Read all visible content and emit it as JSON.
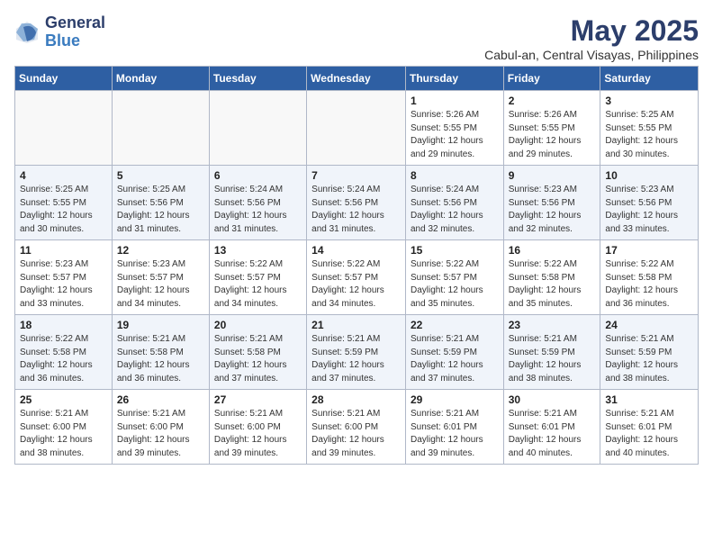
{
  "logo": {
    "general": "General",
    "blue": "Blue"
  },
  "header": {
    "month_year": "May 2025",
    "location": "Cabul-an, Central Visayas, Philippines"
  },
  "weekdays": [
    "Sunday",
    "Monday",
    "Tuesday",
    "Wednesday",
    "Thursday",
    "Friday",
    "Saturday"
  ],
  "weeks": [
    [
      {
        "day": "",
        "info": ""
      },
      {
        "day": "",
        "info": ""
      },
      {
        "day": "",
        "info": ""
      },
      {
        "day": "",
        "info": ""
      },
      {
        "day": "1",
        "info": "Sunrise: 5:26 AM\nSunset: 5:55 PM\nDaylight: 12 hours\nand 29 minutes."
      },
      {
        "day": "2",
        "info": "Sunrise: 5:26 AM\nSunset: 5:55 PM\nDaylight: 12 hours\nand 29 minutes."
      },
      {
        "day": "3",
        "info": "Sunrise: 5:25 AM\nSunset: 5:55 PM\nDaylight: 12 hours\nand 30 minutes."
      }
    ],
    [
      {
        "day": "4",
        "info": "Sunrise: 5:25 AM\nSunset: 5:55 PM\nDaylight: 12 hours\nand 30 minutes."
      },
      {
        "day": "5",
        "info": "Sunrise: 5:25 AM\nSunset: 5:56 PM\nDaylight: 12 hours\nand 31 minutes."
      },
      {
        "day": "6",
        "info": "Sunrise: 5:24 AM\nSunset: 5:56 PM\nDaylight: 12 hours\nand 31 minutes."
      },
      {
        "day": "7",
        "info": "Sunrise: 5:24 AM\nSunset: 5:56 PM\nDaylight: 12 hours\nand 31 minutes."
      },
      {
        "day": "8",
        "info": "Sunrise: 5:24 AM\nSunset: 5:56 PM\nDaylight: 12 hours\nand 32 minutes."
      },
      {
        "day": "9",
        "info": "Sunrise: 5:23 AM\nSunset: 5:56 PM\nDaylight: 12 hours\nand 32 minutes."
      },
      {
        "day": "10",
        "info": "Sunrise: 5:23 AM\nSunset: 5:56 PM\nDaylight: 12 hours\nand 33 minutes."
      }
    ],
    [
      {
        "day": "11",
        "info": "Sunrise: 5:23 AM\nSunset: 5:57 PM\nDaylight: 12 hours\nand 33 minutes."
      },
      {
        "day": "12",
        "info": "Sunrise: 5:23 AM\nSunset: 5:57 PM\nDaylight: 12 hours\nand 34 minutes."
      },
      {
        "day": "13",
        "info": "Sunrise: 5:22 AM\nSunset: 5:57 PM\nDaylight: 12 hours\nand 34 minutes."
      },
      {
        "day": "14",
        "info": "Sunrise: 5:22 AM\nSunset: 5:57 PM\nDaylight: 12 hours\nand 34 minutes."
      },
      {
        "day": "15",
        "info": "Sunrise: 5:22 AM\nSunset: 5:57 PM\nDaylight: 12 hours\nand 35 minutes."
      },
      {
        "day": "16",
        "info": "Sunrise: 5:22 AM\nSunset: 5:58 PM\nDaylight: 12 hours\nand 35 minutes."
      },
      {
        "day": "17",
        "info": "Sunrise: 5:22 AM\nSunset: 5:58 PM\nDaylight: 12 hours\nand 36 minutes."
      }
    ],
    [
      {
        "day": "18",
        "info": "Sunrise: 5:22 AM\nSunset: 5:58 PM\nDaylight: 12 hours\nand 36 minutes."
      },
      {
        "day": "19",
        "info": "Sunrise: 5:21 AM\nSunset: 5:58 PM\nDaylight: 12 hours\nand 36 minutes."
      },
      {
        "day": "20",
        "info": "Sunrise: 5:21 AM\nSunset: 5:58 PM\nDaylight: 12 hours\nand 37 minutes."
      },
      {
        "day": "21",
        "info": "Sunrise: 5:21 AM\nSunset: 5:59 PM\nDaylight: 12 hours\nand 37 minutes."
      },
      {
        "day": "22",
        "info": "Sunrise: 5:21 AM\nSunset: 5:59 PM\nDaylight: 12 hours\nand 37 minutes."
      },
      {
        "day": "23",
        "info": "Sunrise: 5:21 AM\nSunset: 5:59 PM\nDaylight: 12 hours\nand 38 minutes."
      },
      {
        "day": "24",
        "info": "Sunrise: 5:21 AM\nSunset: 5:59 PM\nDaylight: 12 hours\nand 38 minutes."
      }
    ],
    [
      {
        "day": "25",
        "info": "Sunrise: 5:21 AM\nSunset: 6:00 PM\nDaylight: 12 hours\nand 38 minutes."
      },
      {
        "day": "26",
        "info": "Sunrise: 5:21 AM\nSunset: 6:00 PM\nDaylight: 12 hours\nand 39 minutes."
      },
      {
        "day": "27",
        "info": "Sunrise: 5:21 AM\nSunset: 6:00 PM\nDaylight: 12 hours\nand 39 minutes."
      },
      {
        "day": "28",
        "info": "Sunrise: 5:21 AM\nSunset: 6:00 PM\nDaylight: 12 hours\nand 39 minutes."
      },
      {
        "day": "29",
        "info": "Sunrise: 5:21 AM\nSunset: 6:01 PM\nDaylight: 12 hours\nand 39 minutes."
      },
      {
        "day": "30",
        "info": "Sunrise: 5:21 AM\nSunset: 6:01 PM\nDaylight: 12 hours\nand 40 minutes."
      },
      {
        "day": "31",
        "info": "Sunrise: 5:21 AM\nSunset: 6:01 PM\nDaylight: 12 hours\nand 40 minutes."
      }
    ]
  ]
}
